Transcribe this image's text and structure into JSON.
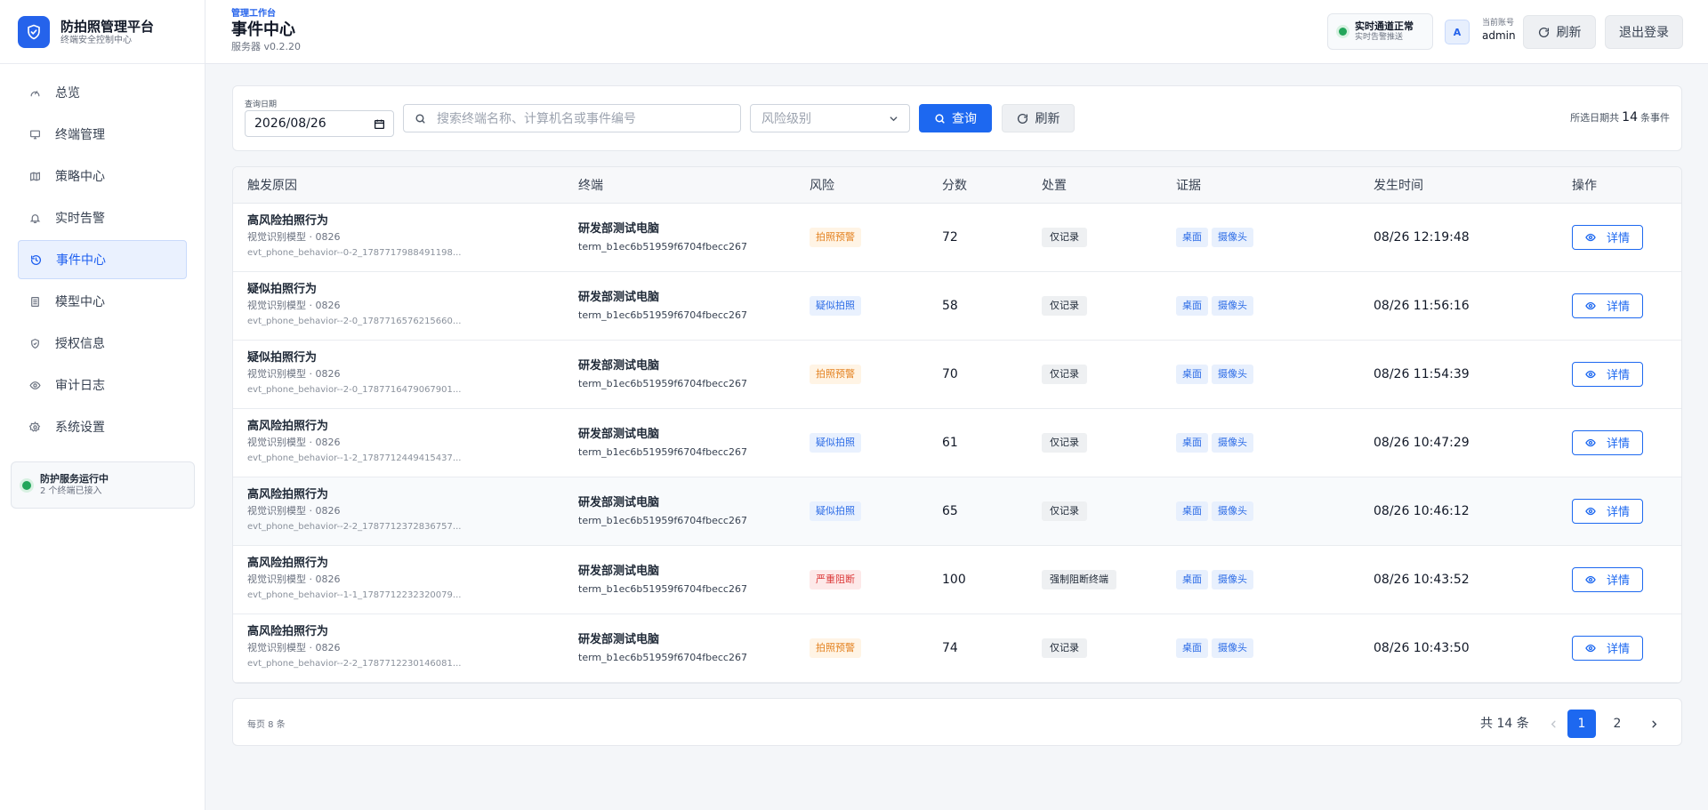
{
  "brand": {
    "title": "防拍照管理平台",
    "subtitle": "终端安全控制中心"
  },
  "sidebar": {
    "items": [
      {
        "label": "总览",
        "icon": "gauge-icon"
      },
      {
        "label": "终端管理",
        "icon": "monitor-icon"
      },
      {
        "label": "策略中心",
        "icon": "map-icon"
      },
      {
        "label": "实时告警",
        "icon": "bell-icon"
      },
      {
        "label": "事件中心",
        "icon": "history-icon",
        "active": true
      },
      {
        "label": "模型中心",
        "icon": "layers-icon"
      },
      {
        "label": "授权信息",
        "icon": "shield-icon"
      },
      {
        "label": "审计日志",
        "icon": "eye-icon"
      },
      {
        "label": "系统设置",
        "icon": "gear-icon"
      }
    ],
    "service": {
      "title": "防护服务运行中",
      "subtitle": "2 个终端已接入"
    }
  },
  "header": {
    "crumb": "管理工作台",
    "title": "事件中心",
    "server": "服务器 v0.2.20",
    "live_title": "实时通道正常",
    "live_sub": "实时告警推送",
    "avatar": "A",
    "account_label": "当前账号",
    "account_name": "admin",
    "refresh_label": "刷新",
    "logout_label": "退出登录"
  },
  "filter": {
    "date_label": "查询日期",
    "date_value": "2026/08/26",
    "search_placeholder": "搜索终端名称、计算机名或事件编号",
    "risk_placeholder": "风险级别",
    "query_label": "查询",
    "refresh_label": "刷新",
    "total_prefix": "所选日期共",
    "total_count": "14",
    "total_suffix": "条事件"
  },
  "table": {
    "headers": [
      "触发原因",
      "终端",
      "风险",
      "分数",
      "处置",
      "证据",
      "发生时间",
      "操作"
    ],
    "rows": [
      {
        "reason": "高风险拍照行为",
        "model": "视觉识别模型 · 0826",
        "event_id": "evt_phone_behavior--0-2_1787717988491198...",
        "terminal": "研发部测试电脑",
        "terminal_id": "term_b1ec6b51959f6704fbecc267",
        "risk": "拍照预警",
        "risk_color": "orange",
        "score": "72",
        "action": "仅记录",
        "ev1": "桌面",
        "ev2": "摄像头",
        "time": "08/26 12:19:48",
        "detail": "详情"
      },
      {
        "reason": "疑似拍照行为",
        "model": "视觉识别模型 · 0826",
        "event_id": "evt_phone_behavior--2-0_1787716576215660...",
        "terminal": "研发部测试电脑",
        "terminal_id": "term_b1ec6b51959f6704fbecc267",
        "risk": "疑似拍照",
        "risk_color": "blue",
        "score": "58",
        "action": "仅记录",
        "ev1": "桌面",
        "ev2": "摄像头",
        "time": "08/26 11:56:16",
        "detail": "详情"
      },
      {
        "reason": "疑似拍照行为",
        "model": "视觉识别模型 · 0826",
        "event_id": "evt_phone_behavior--2-0_1787716479067901...",
        "terminal": "研发部测试电脑",
        "terminal_id": "term_b1ec6b51959f6704fbecc267",
        "risk": "拍照预警",
        "risk_color": "orange",
        "score": "70",
        "action": "仅记录",
        "ev1": "桌面",
        "ev2": "摄像头",
        "time": "08/26 11:54:39",
        "detail": "详情"
      },
      {
        "reason": "高风险拍照行为",
        "model": "视觉识别模型 · 0826",
        "event_id": "evt_phone_behavior--1-2_1787712449415437...",
        "terminal": "研发部测试电脑",
        "terminal_id": "term_b1ec6b51959f6704fbecc267",
        "risk": "疑似拍照",
        "risk_color": "blue",
        "score": "61",
        "action": "仅记录",
        "ev1": "桌面",
        "ev2": "摄像头",
        "time": "08/26 10:47:29",
        "detail": "详情"
      },
      {
        "reason": "高风险拍照行为",
        "model": "视觉识别模型 · 0826",
        "event_id": "evt_phone_behavior--2-2_1787712372836757...",
        "terminal": "研发部测试电脑",
        "terminal_id": "term_b1ec6b51959f6704fbecc267",
        "risk": "疑似拍照",
        "risk_color": "blue",
        "score": "65",
        "action": "仅记录",
        "ev1": "桌面",
        "ev2": "摄像头",
        "time": "08/26 10:46:12",
        "detail": "详情",
        "highlight": true
      },
      {
        "reason": "高风险拍照行为",
        "model": "视觉识别模型 · 0826",
        "event_id": "evt_phone_behavior--1-1_1787712232320079...",
        "terminal": "研发部测试电脑",
        "terminal_id": "term_b1ec6b51959f6704fbecc267",
        "risk": "严重阻断",
        "risk_color": "red",
        "score": "100",
        "action": "强制阻断终端",
        "ev1": "桌面",
        "ev2": "摄像头",
        "time": "08/26 10:43:52",
        "detail": "详情"
      },
      {
        "reason": "高风险拍照行为",
        "model": "视觉识别模型 · 0826",
        "event_id": "evt_phone_behavior--2-2_1787712230146081...",
        "terminal": "研发部测试电脑",
        "terminal_id": "term_b1ec6b51959f6704fbecc267",
        "risk": "拍照预警",
        "risk_color": "orange",
        "score": "74",
        "action": "仅记录",
        "ev1": "桌面",
        "ev2": "摄像头",
        "time": "08/26 10:43:50",
        "detail": "详情"
      }
    ]
  },
  "pager": {
    "per_page": "每页 8 条",
    "total": "共 14 条",
    "pages": [
      "1",
      "2"
    ],
    "current": "1"
  },
  "colors": {
    "primary": "#1d68f0",
    "success": "#22a55a",
    "warning": "#e3811f",
    "danger": "#dc3b3b"
  }
}
